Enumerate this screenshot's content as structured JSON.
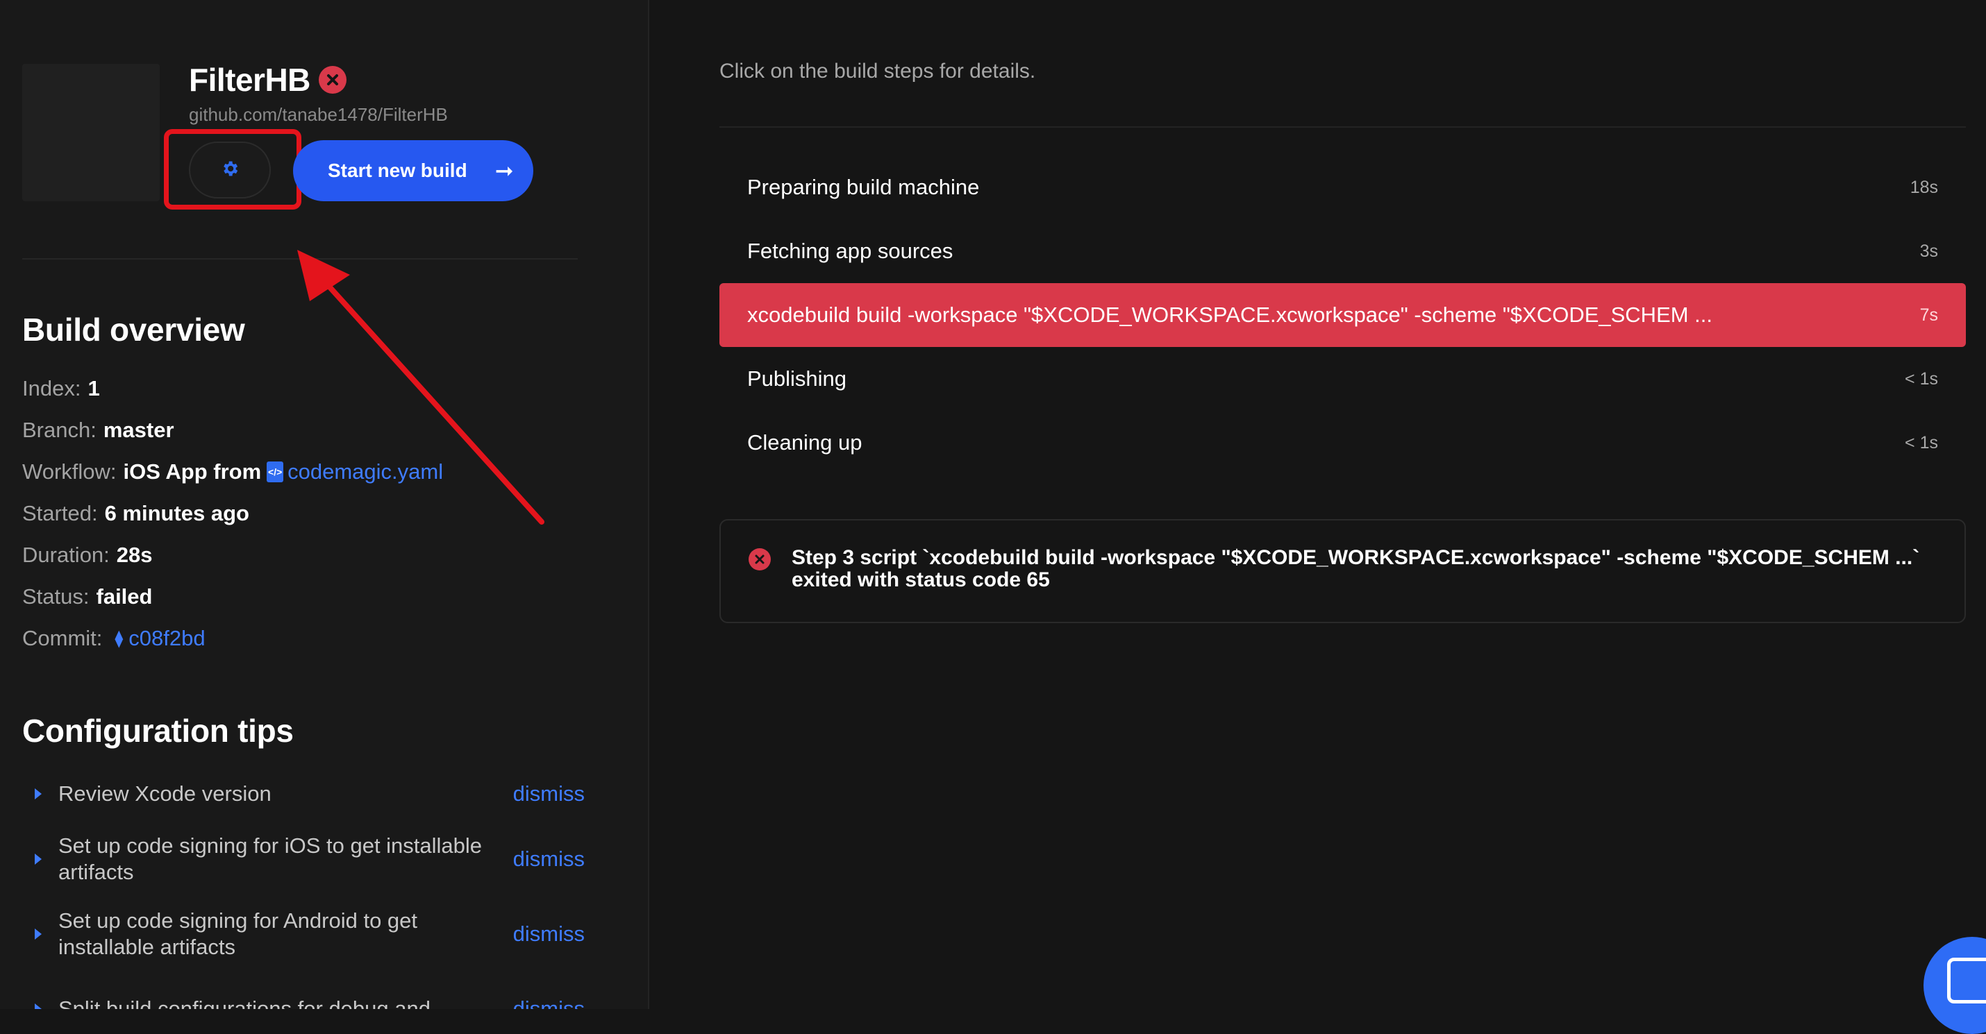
{
  "app": {
    "name": "FilterHB",
    "url": "github.com/tanabe1478/FilterHB",
    "start_build_label": "Start new build",
    "status_color": "#d9394a",
    "accent_color": "#2658f0"
  },
  "overview": {
    "title": "Build overview",
    "index_label": "Index:",
    "index_value": "1",
    "branch_label": "Branch:",
    "branch_value": "master",
    "workflow_label": "Workflow:",
    "workflow_value": "iOS App from",
    "workflow_file": "codemagic.yaml",
    "started_label": "Started:",
    "started_value": "6 minutes ago",
    "duration_label": "Duration:",
    "duration_value": "28s",
    "status_label": "Status:",
    "status_value": "failed",
    "commit_label": "Commit:",
    "commit_value": "c08f2bd"
  },
  "tips": {
    "title": "Configuration tips",
    "items": [
      {
        "text": "Review Xcode version",
        "dismiss": "dismiss"
      },
      {
        "text": "Set up code signing for iOS to get installable artifacts",
        "dismiss": "dismiss"
      },
      {
        "text": "Set up code signing for Android to get installable artifacts",
        "dismiss": "dismiss"
      },
      {
        "text": "Split build configurations for debug and",
        "dismiss": "dismiss"
      }
    ]
  },
  "main": {
    "hint": "Click on the build steps for details.",
    "steps": [
      {
        "label": "Preparing build machine",
        "duration": "18s"
      },
      {
        "label": "Fetching app sources",
        "duration": "3s"
      },
      {
        "label": "xcodebuild build -workspace \"$XCODE_WORKSPACE.xcworkspace\" -scheme \"$XCODE_SCHEM ...",
        "duration": "7s"
      },
      {
        "label": "Publishing",
        "duration": "< 1s"
      },
      {
        "label": "Cleaning up",
        "duration": "< 1s"
      }
    ],
    "error_message": "Step 3 script `xcodebuild build -workspace \"$XCODE_WORKSPACE.xcworkspace\" -scheme \"$XCODE_SCHEM ...` exited with status code 65"
  },
  "icons": {
    "settings": "gear-icon",
    "fail": "close-circle-icon",
    "arrow": "arrow-right-icon",
    "commit": "commit-icon",
    "file": "code-file-icon",
    "chat": "chat-icon"
  }
}
